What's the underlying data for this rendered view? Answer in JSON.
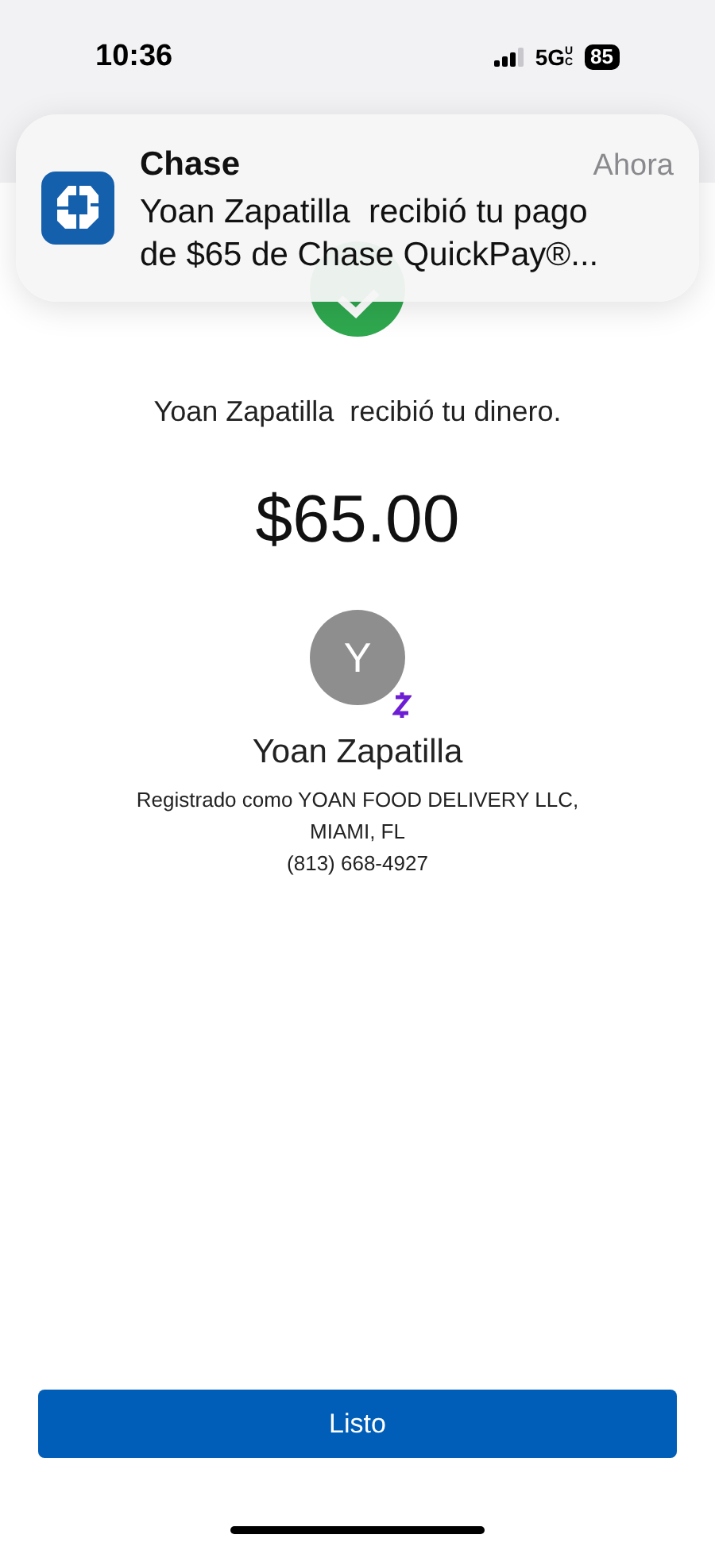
{
  "status_bar": {
    "time": "10:36",
    "network": "5G",
    "network_sub": "UC",
    "battery": "85"
  },
  "notification": {
    "app": "Chase",
    "time": "Ahora",
    "lines": [
      "Yoan Zapatilla  recibió tu pago",
      "de $65 de Chase QuickPay®..."
    ]
  },
  "confirmation": {
    "message": "Yoan Zapatilla  recibió tu dinero.",
    "amount": "$65.00"
  },
  "recipient": {
    "initial": "Y",
    "name": "Yoan Zapatilla",
    "details": [
      "Registrado como YOAN FOOD DELIVERY LLC,",
      "MIAMI, FL",
      "(813) 668-4927"
    ]
  },
  "button": {
    "label": "Listo"
  }
}
